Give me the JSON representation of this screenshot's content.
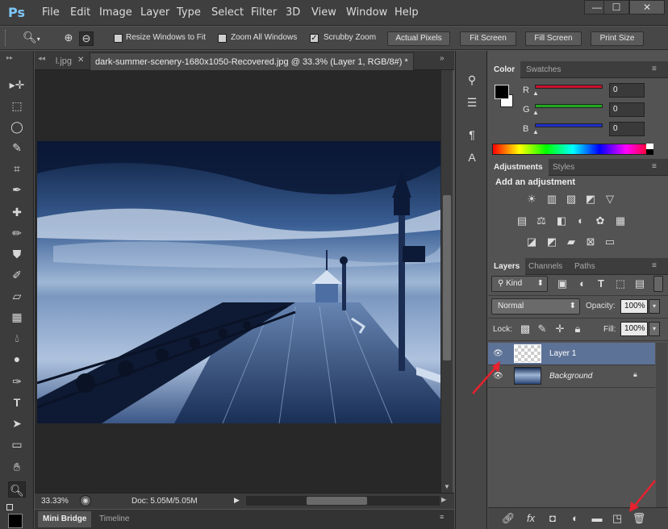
{
  "app": {
    "logo": "Ps"
  },
  "menu": [
    "File",
    "Edit",
    "Image",
    "Layer",
    "Type",
    "Select",
    "Filter",
    "3D",
    "View",
    "Window",
    "Help"
  ],
  "window_controls": {
    "minimize": "—",
    "maximize": "☐",
    "close": "✕"
  },
  "options": {
    "resize_windows": "Resize Windows to Fit",
    "zoom_all": "Zoom All Windows",
    "scrubby_zoom": "Scrubby Zoom",
    "actual_pixels": "Actual Pixels",
    "fit_screen": "Fit Screen",
    "fill_screen": "Fill Screen",
    "print_size": "Print Size",
    "resize_checked": false,
    "zoom_all_checked": false,
    "scrubby_checked": true
  },
  "doc_tabs": [
    {
      "label": "l.jpg"
    },
    {
      "label": "dark-summer-scenery-1680x1050-Recovered.jpg @ 33.3% (Layer 1, RGB/8#) *"
    }
  ],
  "status": {
    "zoom": "33.33%",
    "doc": "Doc: 5.05M/5.05M"
  },
  "bottom_tabs": [
    "Mini Bridge",
    "Timeline"
  ],
  "color_panel": {
    "tabs": [
      "Color",
      "Swatches"
    ],
    "channels": [
      {
        "label": "R",
        "value": "0",
        "color": "#c8102e"
      },
      {
        "label": "G",
        "value": "0",
        "color": "#1fa81f"
      },
      {
        "label": "B",
        "value": "0",
        "color": "#1e2fc8"
      }
    ]
  },
  "adjustments_panel": {
    "tabs": [
      "Adjustments",
      "Styles"
    ],
    "heading": "Add an adjustment"
  },
  "layers_panel": {
    "tabs": [
      "Layers",
      "Channels",
      "Paths"
    ],
    "filter_kind": "Kind",
    "blend_mode": "Normal",
    "opacity_label": "Opacity:",
    "opacity_value": "100%",
    "lock_label": "Lock:",
    "fill_label": "Fill:",
    "fill_value": "100%",
    "layers": [
      {
        "name": "Layer 1",
        "selected": true
      },
      {
        "name": "Background",
        "selected": false
      }
    ]
  }
}
